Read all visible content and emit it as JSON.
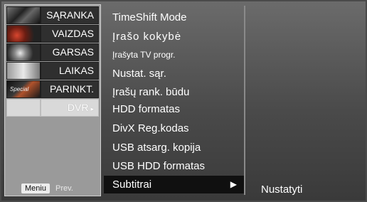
{
  "nav": {
    "items": [
      {
        "label": "SĄRANKA",
        "icon": "setup-thumb-icon"
      },
      {
        "label": "VAIZDAS",
        "icon": "picture-thumb-icon"
      },
      {
        "label": "GARSAS",
        "icon": "audio-thumb-icon"
      },
      {
        "label": "LAIKAS",
        "icon": "time-thumb-icon"
      },
      {
        "label": "PARINKT.",
        "icon": "option-thumb-icon",
        "thumb_text": "Special"
      },
      {
        "label": "DVR",
        "icon": "dvr-thumb-icon",
        "selected": true,
        "arrow": "▸"
      }
    ],
    "menu_button": "Meniu",
    "prev_label": "Prev."
  },
  "menu": {
    "items": [
      {
        "label": "TimeShift Mode"
      },
      {
        "label": "Įrašo kokybė"
      },
      {
        "label": "Įrašyta TV progr."
      },
      {
        "label": "Nustat. sąr."
      },
      {
        "label": "Įrašų rank. būdu"
      },
      {
        "label": "HDD formatas"
      },
      {
        "label": "DivX Reg.kodas"
      },
      {
        "label": "USB atsarg. kopija"
      },
      {
        "label": "USB HDD formatas"
      },
      {
        "label": "Subtitrai",
        "selected": true,
        "arrow": "▶"
      }
    ]
  },
  "submenu": {
    "value": "Nustatyti"
  },
  "colors": {
    "background": "#4a4a4a",
    "selected_item": "#101010",
    "nav_selected": "#d9d9d9"
  }
}
